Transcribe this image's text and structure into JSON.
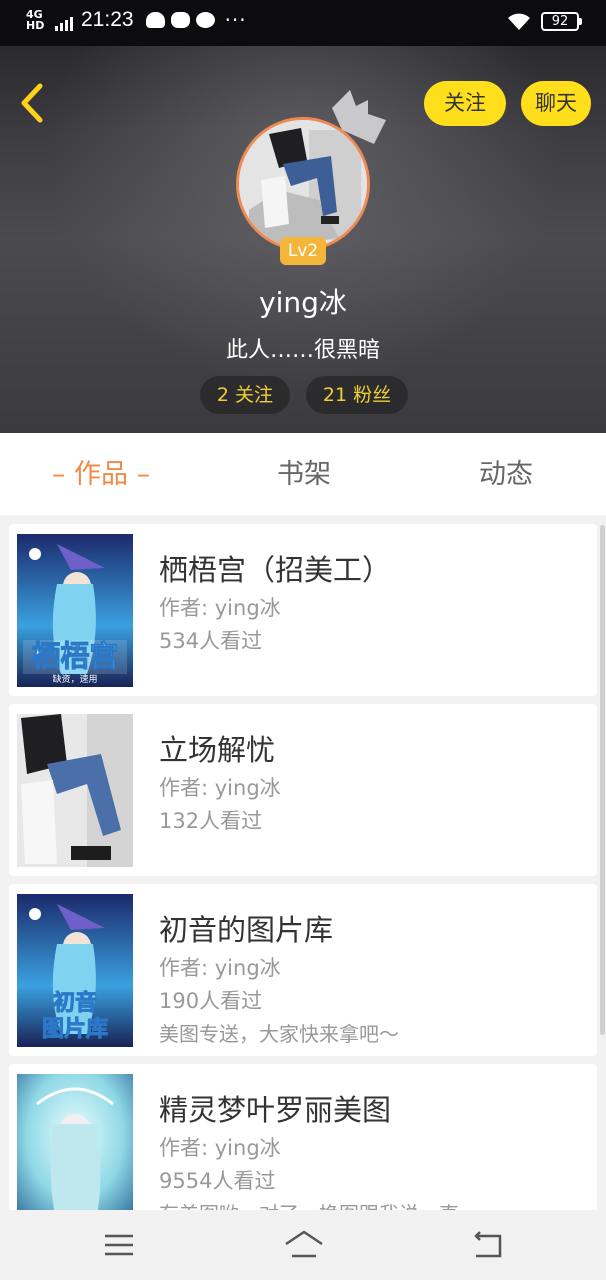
{
  "status_bar": {
    "network": "4G HD",
    "time": "21:23",
    "more": "···",
    "battery": "92"
  },
  "header": {
    "follow_button": "关注",
    "chat_button": "聊天",
    "level": "Lv2",
    "username": "ying冰",
    "bio": "此人……很黑暗",
    "following": "2 关注",
    "fans": "21 粉丝"
  },
  "tabs": [
    {
      "label": "– 作品 –",
      "active": true
    },
    {
      "label": "书架",
      "active": false
    },
    {
      "label": "动态",
      "active": false
    }
  ],
  "works": [
    {
      "title": "栖梧宫（招美工）",
      "author": "作者: ying冰",
      "views": "534人看过",
      "desc": "",
      "cover_text": "栖梧宫",
      "cover_sub": "缺资，速用"
    },
    {
      "title": "立场解忧",
      "author": "作者: ying冰",
      "views": "132人看过",
      "desc": ""
    },
    {
      "title": "初音的图片库",
      "author": "作者: ying冰",
      "views": "190人看过",
      "desc": "美图专送，大家快来拿吧～",
      "cover_text": "初音图片库"
    },
    {
      "title": "精灵梦叶罗丽美图",
      "author": "作者: ying冰",
      "views": "9554人看过",
      "desc": "有美图哟，对了，换图跟我说，直"
    }
  ],
  "colors": {
    "accent": "#f08a45",
    "button_yellow": "#ffdf1b",
    "fans_text": "#f0cf35",
    "level_badge": "#f3b63a"
  },
  "icons": [
    "back-arrow-icon",
    "crown-icon",
    "menu-icon",
    "home-icon",
    "return-icon",
    "wifi-icon"
  ]
}
